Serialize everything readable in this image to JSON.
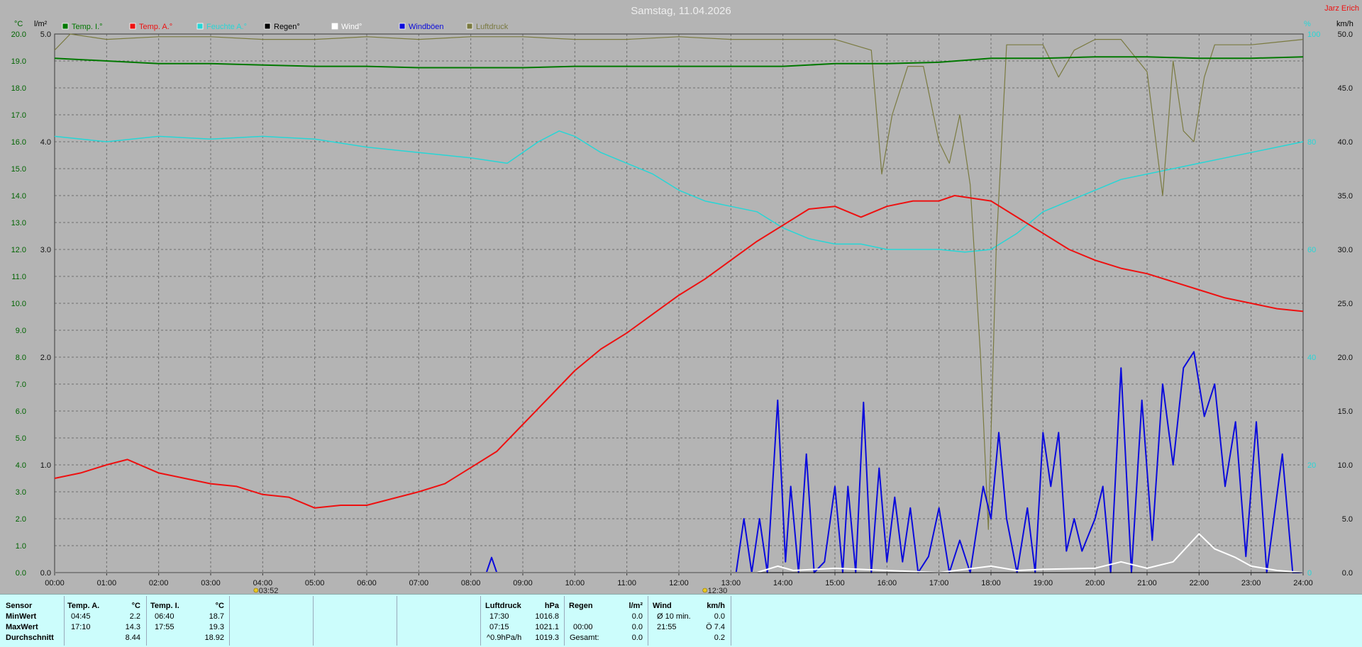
{
  "title": "Samstag, 11.04.2026",
  "author": "Jarz Erich",
  "colors": {
    "temp_i": "#007800",
    "temp_a": "#ee1010",
    "humidity": "#26d6d6",
    "regen": "#000000",
    "wind": "#ffffff",
    "windboen": "#0a0adc",
    "luftdruck": "#7a7a40"
  },
  "legend": [
    {
      "label": "Temp. I.°",
      "color": "#007800"
    },
    {
      "label": "Temp. A.°",
      "color": "#ee1010"
    },
    {
      "label": "Feuchte A.°",
      "color": "#26d6d6"
    },
    {
      "label": "Regen°",
      "color": "#000000"
    },
    {
      "label": "Wind°",
      "color": "#ffffff"
    },
    {
      "label": "Windböen",
      "color": "#0a0adc"
    },
    {
      "label": "Luftdruck",
      "color": "#7a7a40"
    }
  ],
  "axes": {
    "unit_temp": "°C",
    "unit_rain": "l/m²",
    "unit_hum": "%",
    "unit_wind": "km/h",
    "temp_ticks": [
      "0.0",
      "1.0",
      "2.0",
      "3.0",
      "4.0",
      "5.0",
      "6.0",
      "7.0",
      "8.0",
      "9.0",
      "10.0",
      "11.0",
      "12.0",
      "13.0",
      "14.0",
      "15.0",
      "16.0",
      "17.0",
      "18.0",
      "19.0",
      "20.0"
    ],
    "rain_ticks": [
      "0.0",
      "1.0",
      "2.0",
      "3.0",
      "4.0",
      "5.0"
    ],
    "hum_ticks": [
      "0",
      "20",
      "40",
      "60",
      "80",
      "100"
    ],
    "wind_ticks": [
      "0.0",
      "5.0",
      "10.0",
      "15.0",
      "20.0",
      "25.0",
      "30.0",
      "35.0",
      "40.0",
      "45.0",
      "50.0"
    ],
    "x_ticks": [
      "00:00",
      "01:00",
      "02:00",
      "03:00",
      "04:00",
      "05:00",
      "06:00",
      "07:00",
      "08:00",
      "09:00",
      "10:00",
      "11:00",
      "12:00",
      "13:00",
      "14:00",
      "15:00",
      "16:00",
      "17:00",
      "18:00",
      "19:00",
      "20:00",
      "21:00",
      "22:00",
      "23:00",
      "24:00"
    ]
  },
  "markers": [
    {
      "label": "03:52",
      "x": 3.87
    },
    {
      "label": "12:30",
      "x": 12.5
    }
  ],
  "chart_data": {
    "type": "line",
    "title": "Samstag, 11.04.2026",
    "xlabel": "",
    "x_unit": "hours",
    "xlim": [
      0,
      24
    ],
    "ylim_temp": [
      0,
      20
    ],
    "ylim_rain": [
      0,
      5
    ],
    "ylim_hum": [
      0,
      100
    ],
    "ylim_wind": [
      0,
      50
    ],
    "grid": true,
    "legend_position": "top",
    "series": [
      {
        "name": "Temp. I.°",
        "axis": "temp",
        "points": [
          [
            0,
            19.1
          ],
          [
            1,
            19.0
          ],
          [
            2,
            18.9
          ],
          [
            3,
            18.9
          ],
          [
            4,
            18.85
          ],
          [
            5,
            18.8
          ],
          [
            6,
            18.8
          ],
          [
            7,
            18.75
          ],
          [
            8,
            18.75
          ],
          [
            9,
            18.75
          ],
          [
            10,
            18.8
          ],
          [
            11,
            18.8
          ],
          [
            12,
            18.8
          ],
          [
            13,
            18.8
          ],
          [
            14,
            18.8
          ],
          [
            15,
            18.9
          ],
          [
            16,
            18.9
          ],
          [
            17,
            18.95
          ],
          [
            18,
            19.1
          ],
          [
            19,
            19.1
          ],
          [
            20,
            19.15
          ],
          [
            21,
            19.15
          ],
          [
            22,
            19.1
          ],
          [
            23,
            19.1
          ],
          [
            24,
            19.15
          ]
        ]
      },
      {
        "name": "Temp. A.°",
        "axis": "temp",
        "points": [
          [
            0,
            3.5
          ],
          [
            0.5,
            3.7
          ],
          [
            1,
            4.0
          ],
          [
            1.4,
            4.2
          ],
          [
            2,
            3.7
          ],
          [
            2.5,
            3.5
          ],
          [
            3,
            3.3
          ],
          [
            3.5,
            3.2
          ],
          [
            4,
            2.9
          ],
          [
            4.5,
            2.8
          ],
          [
            5,
            2.4
          ],
          [
            5.5,
            2.5
          ],
          [
            6,
            2.5
          ],
          [
            7,
            3.0
          ],
          [
            7.5,
            3.3
          ],
          [
            8,
            3.9
          ],
          [
            8.5,
            4.5
          ],
          [
            9,
            5.5
          ],
          [
            9.5,
            6.5
          ],
          [
            10,
            7.5
          ],
          [
            10.5,
            8.3
          ],
          [
            11,
            8.9
          ],
          [
            11.5,
            9.6
          ],
          [
            12,
            10.3
          ],
          [
            12.5,
            10.9
          ],
          [
            13,
            11.6
          ],
          [
            13.5,
            12.3
          ],
          [
            14,
            12.9
          ],
          [
            14.5,
            13.5
          ],
          [
            15,
            13.6
          ],
          [
            15.5,
            13.2
          ],
          [
            16,
            13.6
          ],
          [
            16.5,
            13.8
          ],
          [
            17,
            13.8
          ],
          [
            17.3,
            14.0
          ],
          [
            18,
            13.8
          ],
          [
            18.5,
            13.2
          ],
          [
            19,
            12.6
          ],
          [
            19.5,
            12.0
          ],
          [
            20,
            11.6
          ],
          [
            20.5,
            11.3
          ],
          [
            21,
            11.1
          ],
          [
            21.5,
            10.8
          ],
          [
            22,
            10.5
          ],
          [
            22.5,
            10.2
          ],
          [
            23,
            10.0
          ],
          [
            23.5,
            9.8
          ],
          [
            24,
            9.7
          ]
        ]
      },
      {
        "name": "Feuchte A.°",
        "axis": "hum",
        "points": [
          [
            0,
            81
          ],
          [
            1,
            80
          ],
          [
            2,
            81
          ],
          [
            3,
            80.5
          ],
          [
            4,
            81
          ],
          [
            5,
            80.5
          ],
          [
            6,
            79
          ],
          [
            7,
            78
          ],
          [
            8,
            77
          ],
          [
            8.7,
            76
          ],
          [
            9.3,
            80
          ],
          [
            9.7,
            82
          ],
          [
            10,
            81
          ],
          [
            10.5,
            78
          ],
          [
            11,
            76
          ],
          [
            11.5,
            74
          ],
          [
            12,
            71
          ],
          [
            12.5,
            69
          ],
          [
            13,
            68
          ],
          [
            13.5,
            67
          ],
          [
            14,
            64
          ],
          [
            14.5,
            62
          ],
          [
            15,
            61
          ],
          [
            15.5,
            61
          ],
          [
            16,
            60
          ],
          [
            16.5,
            60
          ],
          [
            17,
            60
          ],
          [
            17.5,
            59.5
          ],
          [
            18,
            60
          ],
          [
            18.5,
            63
          ],
          [
            19,
            67
          ],
          [
            19.5,
            69
          ],
          [
            20,
            71
          ],
          [
            20.5,
            73
          ],
          [
            21,
            74
          ],
          [
            21.5,
            75
          ],
          [
            22,
            76
          ],
          [
            22.5,
            77
          ],
          [
            23,
            78
          ],
          [
            23.5,
            79
          ],
          [
            24,
            80
          ]
        ]
      },
      {
        "name": "Luftdruck",
        "axis": "hum",
        "points": [
          [
            0,
            97
          ],
          [
            0.3,
            100
          ],
          [
            1,
            99
          ],
          [
            2,
            99.5
          ],
          [
            3,
            99.5
          ],
          [
            4,
            99
          ],
          [
            5,
            99
          ],
          [
            6,
            99.5
          ],
          [
            7,
            99
          ],
          [
            8,
            99.5
          ],
          [
            9,
            99.5
          ],
          [
            10,
            99
          ],
          [
            11,
            99
          ],
          [
            12,
            99.5
          ],
          [
            13,
            99
          ],
          [
            14,
            99
          ],
          [
            15,
            99
          ],
          [
            15.7,
            97
          ],
          [
            15.9,
            74
          ],
          [
            16.1,
            85
          ],
          [
            16.4,
            94
          ],
          [
            16.7,
            94
          ],
          [
            17.0,
            80
          ],
          [
            17.2,
            76
          ],
          [
            17.4,
            85
          ],
          [
            17.6,
            72
          ],
          [
            17.8,
            40
          ],
          [
            17.95,
            8
          ],
          [
            18.1,
            60
          ],
          [
            18.3,
            98
          ],
          [
            18.6,
            98
          ],
          [
            19,
            98
          ],
          [
            19.3,
            92
          ],
          [
            19.6,
            97
          ],
          [
            20,
            99
          ],
          [
            20.5,
            99
          ],
          [
            21,
            93
          ],
          [
            21.3,
            70
          ],
          [
            21.5,
            95
          ],
          [
            21.7,
            82
          ],
          [
            21.9,
            80
          ],
          [
            22.1,
            92
          ],
          [
            22.3,
            98
          ],
          [
            23,
            98
          ],
          [
            24,
            99
          ]
        ]
      },
      {
        "name": "Windböen",
        "axis": "wind",
        "points": [
          [
            0,
            0
          ],
          [
            8.3,
            0
          ],
          [
            8.4,
            1.4
          ],
          [
            8.5,
            0
          ],
          [
            13.1,
            0
          ],
          [
            13.25,
            5
          ],
          [
            13.4,
            0
          ],
          [
            13.55,
            5
          ],
          [
            13.7,
            0
          ],
          [
            13.9,
            16
          ],
          [
            14.05,
            1
          ],
          [
            14.15,
            8
          ],
          [
            14.3,
            0
          ],
          [
            14.45,
            11
          ],
          [
            14.6,
            0
          ],
          [
            14.8,
            1
          ],
          [
            15.0,
            8
          ],
          [
            15.15,
            0
          ],
          [
            15.25,
            8
          ],
          [
            15.4,
            0
          ],
          [
            15.55,
            15.8
          ],
          [
            15.7,
            0
          ],
          [
            15.85,
            9.7
          ],
          [
            16.0,
            1
          ],
          [
            16.15,
            7
          ],
          [
            16.3,
            1
          ],
          [
            16.45,
            6
          ],
          [
            16.6,
            0
          ],
          [
            16.8,
            1.5
          ],
          [
            17.0,
            6
          ],
          [
            17.2,
            0
          ],
          [
            17.4,
            3
          ],
          [
            17.6,
            0
          ],
          [
            17.85,
            8
          ],
          [
            18.0,
            5
          ],
          [
            18.15,
            13
          ],
          [
            18.3,
            5
          ],
          [
            18.5,
            0
          ],
          [
            18.7,
            6
          ],
          [
            18.85,
            0
          ],
          [
            19.0,
            13
          ],
          [
            19.15,
            8
          ],
          [
            19.3,
            13
          ],
          [
            19.45,
            2
          ],
          [
            19.6,
            5
          ],
          [
            19.75,
            2
          ],
          [
            20.0,
            5
          ],
          [
            20.15,
            8
          ],
          [
            20.3,
            0
          ],
          [
            20.5,
            19
          ],
          [
            20.7,
            0
          ],
          [
            20.9,
            16
          ],
          [
            21.1,
            3
          ],
          [
            21.3,
            17.5
          ],
          [
            21.5,
            10
          ],
          [
            21.7,
            19
          ],
          [
            21.9,
            20.5
          ],
          [
            22.1,
            14.5
          ],
          [
            22.3,
            17.5
          ],
          [
            22.5,
            8
          ],
          [
            22.7,
            14
          ],
          [
            22.9,
            1.5
          ],
          [
            23.1,
            14
          ],
          [
            23.3,
            0
          ],
          [
            23.6,
            11
          ],
          [
            23.8,
            0
          ],
          [
            24,
            0
          ]
        ]
      },
      {
        "name": "Wind°",
        "axis": "wind",
        "points": [
          [
            0,
            0
          ],
          [
            13.5,
            0
          ],
          [
            13.9,
            0.6
          ],
          [
            14.2,
            0.2
          ],
          [
            15,
            0.4
          ],
          [
            16,
            0.2
          ],
          [
            17,
            0
          ],
          [
            18,
            0.6
          ],
          [
            18.5,
            0.2
          ],
          [
            19,
            0.3
          ],
          [
            20,
            0.4
          ],
          [
            20.5,
            1.0
          ],
          [
            21,
            0.4
          ],
          [
            21.5,
            1.0
          ],
          [
            22,
            3.6
          ],
          [
            22.3,
            2.2
          ],
          [
            22.7,
            1.4
          ],
          [
            23,
            0.6
          ],
          [
            23.5,
            0.2
          ],
          [
            24,
            0
          ]
        ]
      },
      {
        "name": "Regen°",
        "axis": "rain",
        "points": [
          [
            0,
            0
          ],
          [
            24,
            0
          ]
        ]
      }
    ]
  },
  "stats": {
    "sensor_header": "Sensor",
    "row_labels": [
      "MinWert",
      "MaxWert",
      "Durchschnitt"
    ],
    "temp_a": {
      "header": "Temp. A.",
      "unit": "°C",
      "min_time": "04:45",
      "min": "2.2",
      "max_time": "17:10",
      "max": "14.3",
      "avg": "8.44"
    },
    "temp_i": {
      "header": "Temp. I.",
      "unit": "°C",
      "min_time": "06:40",
      "min": "18.7",
      "max_time": "17:55",
      "max": "19.3",
      "avg": "18.92"
    },
    "luftdruck": {
      "header": "Luftdruck",
      "unit": "hPa",
      "min_time": "17:30",
      "min": "1016.8",
      "max_time": "07:15",
      "max": "1021.1",
      "trend_label": "^0.9hPa/h",
      "avg": "1019.3"
    },
    "regen": {
      "header": "Regen",
      "unit": "l/m²",
      "min": "0.0",
      "time2": "00:00",
      "val2": "0.0",
      "gesamt_label": "Gesamt:",
      "gesamt": "0.0"
    },
    "wind": {
      "header": "Wind",
      "unit": "km/h",
      "r1_label": "Ø 10 min.",
      "r1": "0.0",
      "r2_time": "21:55",
      "r2": "Ö 7.4",
      "r3": "0.2"
    }
  }
}
